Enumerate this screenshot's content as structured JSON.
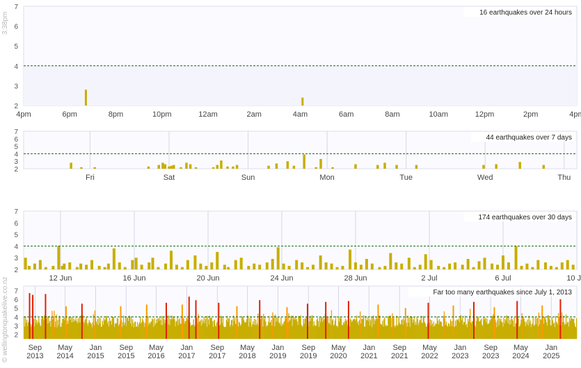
{
  "timestamp": "3:38pm",
  "credit": "© wellingtonquakelive.co.nz",
  "colors": {
    "bar": "#c8ae00",
    "orange": "#ff9900",
    "red": "#e02000",
    "threshold": "#116611",
    "plot_bg": "#f4f4fd",
    "grid": "#d6d6e6"
  },
  "chart_data": [
    {
      "type": "bar",
      "title": "16 earthquakes over 24 hours",
      "ylim": [
        2,
        7
      ],
      "y_ticks": [
        "2",
        "3",
        "4",
        "5",
        "6",
        "7"
      ],
      "x_range": [
        0,
        24
      ],
      "x_tick_labels": [
        "4pm",
        "6pm",
        "8pm",
        "10pm",
        "12am",
        "2am",
        "4am",
        "6am",
        "8am",
        "10am",
        "12pm",
        "2pm",
        "4pm"
      ],
      "x_tick_values": [
        0,
        2,
        4,
        6,
        8,
        10,
        12,
        14,
        16,
        18,
        20,
        22,
        24
      ],
      "threshold": 4,
      "highlight_band": [
        2,
        4
      ],
      "gridlines": false,
      "x": [
        2.7,
        12.1
      ],
      "values": [
        2.8,
        2.4
      ]
    },
    {
      "type": "bar",
      "title": "44 earthquakes over 7 days",
      "ylim": [
        2,
        7
      ],
      "y_ticks": [
        "2",
        "3",
        "4",
        "5",
        "6",
        "7"
      ],
      "x_range": [
        0,
        7
      ],
      "x_tick_labels": [
        "Fri",
        "Sat",
        "Sun",
        "Mon",
        "Tue",
        "Wed",
        "Thu"
      ],
      "x_tick_values": [
        0.84,
        1.84,
        2.84,
        3.84,
        4.84,
        5.84,
        6.84
      ],
      "threshold": 4,
      "gridlines": true,
      "x": [
        0.6,
        0.73,
        0.9,
        1.58,
        1.71,
        1.76,
        1.79,
        1.84,
        1.87,
        1.9,
        1.99,
        2.06,
        2.11,
        2.18,
        2.4,
        2.45,
        2.5,
        2.58,
        2.65,
        2.7,
        3.1,
        3.2,
        3.34,
        3.42,
        3.55,
        3.7,
        3.76,
        3.91,
        4.2,
        4.48,
        4.57,
        4.72,
        4.97,
        5.82,
        5.98,
        6.28,
        6.58
      ],
      "values": [
        2.8,
        2.2,
        2.2,
        2.3,
        2.5,
        2.8,
        2.6,
        2.3,
        2.4,
        2.5,
        2.2,
        2.8,
        2.6,
        2.2,
        2.2,
        2.5,
        3.1,
        2.3,
        2.3,
        2.5,
        2.4,
        2.7,
        3.0,
        2.4,
        3.9,
        2.2,
        3.3,
        2.2,
        2.6,
        2.5,
        2.8,
        2.5,
        2.5,
        2.5,
        2.6,
        2.9,
        2.5
      ]
    },
    {
      "type": "bar",
      "title": "174 earthquakes over 30 days",
      "ylim": [
        2,
        7
      ],
      "y_ticks": [
        "2",
        "3",
        "4",
        "5",
        "6",
        "7"
      ],
      "x_range": [
        0,
        30
      ],
      "x_tick_labels": [
        "12 Jun",
        "16 Jun",
        "20 Jun",
        "24 Jun",
        "28 Jun",
        "2 Jul",
        "6 Jul",
        "10 Jul"
      ],
      "x_tick_values": [
        2,
        6,
        10,
        14,
        18,
        22,
        26,
        30
      ],
      "threshold": 4,
      "gridlines": true,
      "x": [
        0.1,
        0.3,
        0.6,
        0.9,
        1.2,
        1.6,
        1.9,
        2.1,
        2.2,
        2.5,
        2.9,
        3.1,
        3.4,
        3.7,
        4.1,
        4.4,
        4.6,
        4.9,
        5.2,
        5.5,
        5.9,
        6.1,
        6.4,
        6.8,
        7.0,
        7.3,
        7.7,
        8.0,
        8.3,
        8.6,
        8.9,
        9.3,
        9.6,
        9.9,
        10.2,
        10.5,
        10.9,
        11.1,
        11.5,
        11.8,
        12.2,
        12.5,
        12.8,
        13.2,
        13.5,
        13.8,
        14.1,
        14.4,
        14.8,
        15.1,
        15.4,
        15.7,
        16.1,
        16.4,
        16.7,
        17.0,
        17.3,
        17.7,
        18.0,
        18.3,
        18.6,
        18.9,
        19.3,
        19.6,
        19.9,
        20.2,
        20.5,
        20.9,
        21.2,
        21.5,
        21.8,
        22.1,
        22.5,
        22.8,
        23.1,
        23.4,
        23.8,
        24.1,
        24.4,
        24.7,
        25.0,
        25.4,
        25.7,
        26.0,
        26.3,
        26.7,
        27.0,
        27.3,
        27.6,
        27.9,
        28.3,
        28.6,
        28.9,
        29.2,
        29.5,
        29.8
      ],
      "values": [
        3.0,
        2.3,
        2.5,
        2.8,
        2.2,
        2.3,
        4.0,
        2.3,
        2.5,
        2.6,
        2.2,
        2.5,
        2.4,
        2.8,
        2.3,
        2.2,
        2.5,
        3.8,
        2.6,
        2.2,
        2.8,
        3.0,
        2.4,
        2.6,
        3.0,
        2.2,
        2.5,
        3.6,
        2.4,
        2.2,
        2.8,
        3.2,
        2.5,
        2.3,
        2.6,
        3.5,
        2.4,
        2.2,
        2.8,
        3.0,
        2.3,
        2.5,
        2.4,
        2.6,
        2.9,
        3.9,
        2.5,
        2.3,
        2.8,
        2.6,
        2.2,
        2.4,
        3.2,
        2.6,
        2.5,
        2.2,
        2.3,
        3.7,
        2.6,
        2.4,
        2.9,
        2.5,
        2.2,
        2.3,
        3.4,
        2.6,
        2.5,
        3.0,
        2.2,
        2.4,
        3.3,
        2.8,
        2.3,
        2.2,
        2.5,
        2.6,
        2.4,
        2.9,
        2.2,
        2.7,
        3.0,
        2.5,
        2.4,
        3.2,
        2.6,
        4.0,
        2.3,
        2.5,
        2.2,
        2.8,
        2.6,
        2.3,
        2.2,
        2.6,
        2.8,
        2.4
      ]
    },
    {
      "type": "bar",
      "title": "Far too many earthquakes since July 1, 2013",
      "ylim": [
        1.5,
        7.5
      ],
      "y_ticks": [
        "2",
        "3",
        "4",
        "5",
        "6",
        "7"
      ],
      "x_range": [
        2013.42,
        2025.56
      ],
      "x_tick_labels": [
        "Sep\n2013",
        "May\n2014",
        "Jan\n2015",
        "Sep\n2015",
        "May\n2016",
        "Jan\n2017",
        "Sep\n2017",
        "May\n2018",
        "Jan\n2019",
        "Sep\n2019",
        "May\n2020",
        "Jan\n2021",
        "Sep\n2021",
        "May\n2022",
        "Jan\n2023",
        "Sep\n2023",
        "May\n2024",
        "Jan\n2025"
      ],
      "x_tick_values": [
        2013.67,
        2014.33,
        2015.0,
        2015.67,
        2016.33,
        2017.0,
        2017.67,
        2018.33,
        2019.0,
        2019.67,
        2020.33,
        2021.0,
        2021.67,
        2022.33,
        2023.0,
        2023.67,
        2024.33,
        2025.0
      ],
      "threshold": 4,
      "gridlines": true,
      "dense": true,
      "peaks_x": [
        2013.55,
        2013.62,
        2013.9,
        2014.35,
        2014.7,
        2015.55,
        2016.12,
        2016.55,
        2016.9,
        2017.05,
        2017.2,
        2017.7,
        2018.1,
        2018.6,
        2019.2,
        2019.65,
        2020.05,
        2020.55,
        2021.2,
        2021.8,
        2022.3,
        2022.85,
        2023.3,
        2023.75,
        2024.25,
        2024.8,
        2025.2
      ],
      "peaks_values": [
        6.7,
        6.5,
        6.6,
        5.2,
        5.5,
        5.2,
        5.4,
        5.6,
        5.4,
        6.3,
        5.9,
        5.6,
        5.2,
        5.9,
        5.1,
        5.5,
        5.7,
        5.8,
        5.4,
        5.0,
        5.6,
        5.3,
        5.7,
        5.1,
        5.8,
        5.3,
        6.0
      ]
    }
  ]
}
